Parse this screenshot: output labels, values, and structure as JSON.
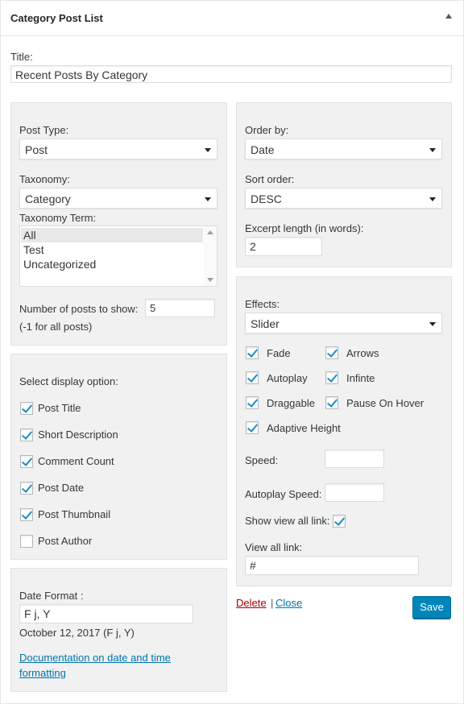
{
  "widget": {
    "title": "Category Post List"
  },
  "title_field": {
    "label": "Title:",
    "value": "Recent Posts By Category"
  },
  "query": {
    "post_type": {
      "label": "Post Type:",
      "value": "Post"
    },
    "taxonomy": {
      "label": "Taxonomy:",
      "value": "Category"
    },
    "taxonomy_term": {
      "label": "Taxonomy Term:",
      "options": [
        "All",
        "Test",
        "Uncategorized"
      ],
      "selected": "All"
    },
    "num_posts": {
      "label": "Number of posts to show:",
      "value": "5",
      "hint": "(-1 for all posts)"
    }
  },
  "display": {
    "heading": "Select display option:",
    "options": [
      {
        "label": "Post Title",
        "checked": true
      },
      {
        "label": "Short Description",
        "checked": true
      },
      {
        "label": "Comment Count",
        "checked": true
      },
      {
        "label": "Post Date",
        "checked": true
      },
      {
        "label": "Post Thumbnail",
        "checked": true
      },
      {
        "label": "Post Author",
        "checked": false
      }
    ]
  },
  "date": {
    "label": "Date Format :",
    "value": "F j, Y",
    "preview": "October 12, 2017 (F j, Y)",
    "doc_link_line1": "Documentation on date and time",
    "doc_link_line2": "formatting"
  },
  "order": {
    "order_by": {
      "label": "Order by:",
      "value": "Date"
    },
    "sort_order": {
      "label": "Sort order:",
      "value": "DESC"
    },
    "excerpt": {
      "label": "Excerpt length (in words):",
      "value": "2"
    }
  },
  "effects": {
    "label": "Effects:",
    "value": "Slider",
    "options": [
      {
        "label": "Fade",
        "checked": true
      },
      {
        "label": "Arrows",
        "checked": true
      },
      {
        "label": "Autoplay",
        "checked": true
      },
      {
        "label": "Infinte",
        "checked": true
      },
      {
        "label": "Draggable",
        "checked": true
      },
      {
        "label": "Pause On Hover",
        "checked": true
      },
      {
        "label": "Adaptive Height",
        "checked": true
      }
    ],
    "speed_label": "Speed:",
    "speed_value": "",
    "autoplay_speed_label": "Autoplay Speed:",
    "autoplay_speed_value": "",
    "show_view_all_label": "Show view all link:",
    "show_view_all_checked": true,
    "view_all_label": "View all link:",
    "view_all_value": "#"
  },
  "actions": {
    "delete": "Delete",
    "separator": "|",
    "close": "Close",
    "save": "Save"
  },
  "colors": {
    "primary": "#0085ba",
    "link": "#0073aa",
    "delete": "#aa0000",
    "check": "#1e8cbe",
    "panel": "#f1f1f1"
  }
}
